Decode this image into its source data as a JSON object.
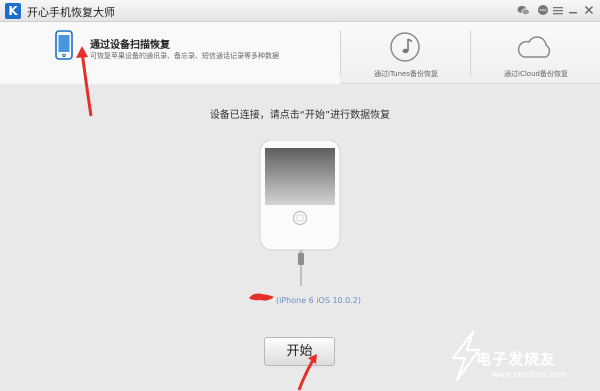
{
  "window": {
    "title": "开心手机恢复大师",
    "logo_letter": "K",
    "controls": [
      "wechat-icon",
      "chat-icon",
      "menu-icon",
      "minimize-icon",
      "close-icon"
    ]
  },
  "tabs": [
    {
      "title": "通过设备扫描恢复",
      "subtitle": "可恢复苹果设备的通讯录、备忘录、短信通话记录等多种数据",
      "icon": "phone-icon",
      "active": true
    },
    {
      "label": "通过iTunes备份恢复",
      "icon": "music-note-icon",
      "active": false
    },
    {
      "label": "通过iCloud备份恢复",
      "icon": "cloud-icon",
      "active": false
    }
  ],
  "main": {
    "prompt": "设备已连接，请点击“开始”进行数据恢复",
    "device_info": "(iPhone 6 iOS 10.0.2)",
    "start_label": "开始"
  },
  "watermark": {
    "text": "电子发烧友",
    "url": "www.elecfans.com"
  },
  "colors": {
    "accent": "#1a6fc9",
    "annotation": "#e8302a",
    "background": "#e9e9e9"
  }
}
